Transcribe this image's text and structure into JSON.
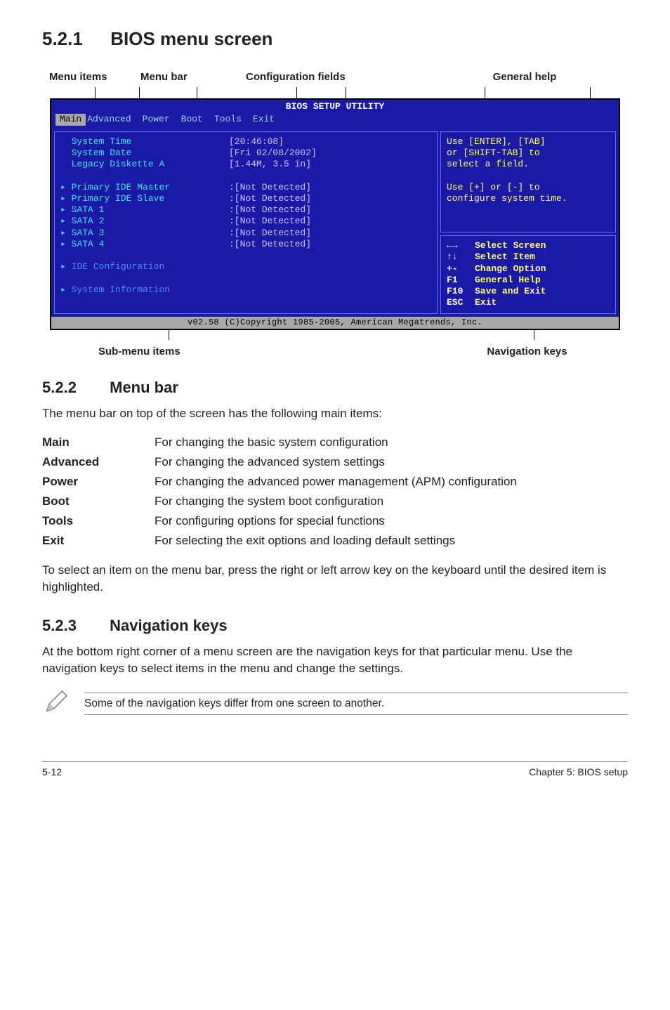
{
  "sections": {
    "s521": {
      "num": "5.2.1",
      "title": "BIOS menu screen"
    },
    "s522": {
      "num": "5.2.2",
      "title": "Menu bar"
    },
    "s523": {
      "num": "5.2.3",
      "title": "Navigation keys"
    }
  },
  "diagram_labels": {
    "menu_items": "Menu items",
    "menu_bar": "Menu bar",
    "config_fields": "Configuration fields",
    "general_help": "General help",
    "sub_menu": "Sub-menu items",
    "nav_keys": "Navigation keys"
  },
  "bios": {
    "title": "BIOS SETUP UTILITY",
    "menubar": [
      "Main",
      "Advanced",
      "Power",
      "Boot",
      "Tools",
      "Exit"
    ],
    "selected_tab": "Main",
    "left_items": [
      {
        "label": "System Time",
        "value": "[20:46:08]",
        "arrow": false,
        "cls": "cyan"
      },
      {
        "label": "System Date",
        "value": "[Fri 02/08/2002]",
        "arrow": false,
        "cls": "cyan"
      },
      {
        "label": "Legacy Diskette A",
        "value": "[1.44M, 3.5 in]",
        "arrow": false,
        "cls": "cyan"
      },
      {
        "label": "",
        "value": "",
        "arrow": false,
        "cls": "cyan"
      },
      {
        "label": "Primary IDE Master",
        "value": ":[Not Detected]",
        "arrow": true,
        "cls": "cyan"
      },
      {
        "label": "Primary IDE Slave",
        "value": ":[Not Detected]",
        "arrow": true,
        "cls": "cyan"
      },
      {
        "label": "SATA 1",
        "value": ":[Not Detected]",
        "arrow": true,
        "cls": "cyan"
      },
      {
        "label": "SATA 2",
        "value": ":[Not Detected]",
        "arrow": true,
        "cls": "cyan"
      },
      {
        "label": "SATA 3",
        "value": ":[Not Detected]",
        "arrow": true,
        "cls": "cyan"
      },
      {
        "label": "SATA 4",
        "value": ":[Not Detected]",
        "arrow": true,
        "cls": "cyan"
      },
      {
        "label": "",
        "value": "",
        "arrow": false,
        "cls": "cyan"
      },
      {
        "label": "IDE Configuration",
        "value": "",
        "arrow": true,
        "cls": "blueitem"
      },
      {
        "label": "",
        "value": "",
        "arrow": false,
        "cls": "cyan"
      },
      {
        "label": "System Information",
        "value": "",
        "arrow": true,
        "cls": "blueitem"
      }
    ],
    "help": [
      "Use [ENTER], [TAB]",
      "or [SHIFT-TAB] to",
      "select a field.",
      "",
      "Use [+] or [-] to",
      "configure system time."
    ],
    "nav": [
      {
        "key": "←→",
        "txt": "Select Screen"
      },
      {
        "key": "↑↓",
        "txt": "Select Item"
      },
      {
        "key": "+-",
        "txt": "Change Option"
      },
      {
        "key": "F1",
        "txt": "General Help"
      },
      {
        "key": "F10",
        "txt": "Save and Exit"
      },
      {
        "key": "ESC",
        "txt": "Exit"
      }
    ],
    "copyright": "v02.58 (C)Copyright 1985-2005, American Megatrends, Inc."
  },
  "s522_intro": "The menu bar on top of the screen has the following main items:",
  "menu_table": [
    {
      "k": "Main",
      "v": "For changing the basic system configuration"
    },
    {
      "k": "Advanced",
      "v": "For changing the advanced system settings"
    },
    {
      "k": "Power",
      "v": "For changing the advanced power management (APM) configuration"
    },
    {
      "k": "Boot",
      "v": "For changing the system boot configuration"
    },
    {
      "k": "Tools",
      "v": "For configuring options for special functions"
    },
    {
      "k": "Exit",
      "v": "For selecting the exit options and loading default settings"
    }
  ],
  "s522_outro": "To select an item on the menu bar, press the right or left arrow key on the keyboard until the desired item is highlighted.",
  "s523_body": "At the bottom right corner of a menu screen are the navigation keys for that particular menu. Use the navigation keys to select items in the menu and change the settings.",
  "note": "Some of the navigation keys differ from one screen to another.",
  "footer": {
    "left": "5-12",
    "right": "Chapter 5: BIOS setup"
  }
}
